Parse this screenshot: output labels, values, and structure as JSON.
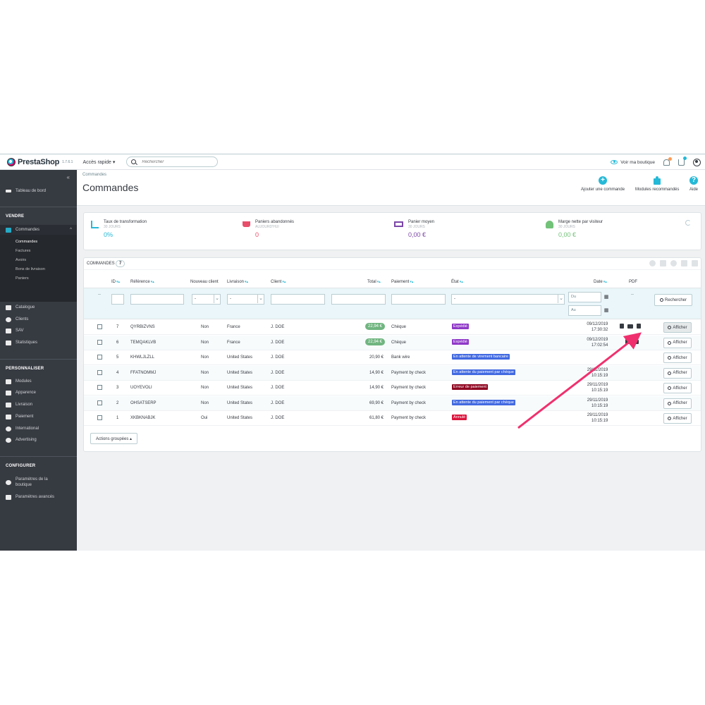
{
  "header": {
    "logo": "PrestaShop",
    "version": "1.7.6.1",
    "quick_access": "Accès rapide ▾",
    "search_placeholder": "Rechercher",
    "view_shop": "Voir ma boutique",
    "colors": {
      "accent": "#25b9d7",
      "brand_pink": "#df0067",
      "notif": "#ff9a52"
    }
  },
  "sidebar": {
    "collapse": "«",
    "dashboard": "Tableau de bord",
    "sections": {
      "sell": "VENDRE",
      "customize": "PERSONNALISER",
      "configure": "CONFIGURER"
    },
    "orders": "Commandes",
    "orders_sub": [
      "Commandes",
      "Factures",
      "Avoirs",
      "Bons de livraison",
      "Paniers"
    ],
    "sell_items": [
      "Catalogue",
      "Clients",
      "SAV",
      "Statistiques"
    ],
    "customize_items": [
      "Modules",
      "Apparence",
      "Livraison",
      "Paiement",
      "International",
      "Advertising"
    ],
    "configure_items": [
      "Paramètres de la boutique",
      "Paramètres avancés"
    ]
  },
  "page": {
    "breadcrumb": "Commandes",
    "title": "Commandes",
    "toolbar": {
      "add_order": "Ajouter une commande",
      "recommended_modules": "Modules recommandés",
      "help": "Aide"
    }
  },
  "kpis": [
    {
      "label": "Taux de transformation",
      "sub": "30 jours",
      "value": "0%",
      "color": "#25b9d7",
      "icon": "sort-chart-icon"
    },
    {
      "label": "Paniers abandonnés",
      "sub": "Aujourd'hui",
      "value": "0",
      "color": "#e84e6a",
      "icon": "cart-icon"
    },
    {
      "label": "Panier moyen",
      "sub": "30 jours",
      "value": "0,00 €",
      "color": "#7c47a8",
      "icon": "money-icon"
    },
    {
      "label": "Marge nette par visiteur",
      "sub": "30 jours",
      "value": "0,00 €",
      "color": "#72c279",
      "icon": "user-icon"
    }
  ],
  "orders": {
    "panel_title": "COMMANDES",
    "count": "7",
    "columns": {
      "id": "ID",
      "reference": "Référence",
      "new_client": "Nouveau client",
      "delivery": "Livraison",
      "client": "Client",
      "total": "Total",
      "payment": "Paiement",
      "state": "État",
      "date": "Date",
      "pdf": "PDF"
    },
    "filters": {
      "dash": "--",
      "select_default": "-",
      "date_from": "Du",
      "date_to": "Au",
      "search_button": "Rechercher"
    },
    "view_label": "Afficher",
    "bulk_actions": "Actions groupées ▴",
    "rows": [
      {
        "id": "7",
        "ref": "QYRBIZVNS",
        "new": "Non",
        "country": "France",
        "client": "J. DOE",
        "total": "22,94 €",
        "total_badge": true,
        "payment": "Chèque",
        "state": "Expédié",
        "state_color": "#8f38c8",
        "date": "09/12/2019",
        "time": "17:30:32",
        "pdf": 3
      },
      {
        "id": "6",
        "ref": "TEMQAKLVB",
        "new": "Non",
        "country": "France",
        "client": "J. DOE",
        "total": "22,94 €",
        "total_badge": true,
        "payment": "Chèque",
        "state": "Expédié",
        "state_color": "#8f38c8",
        "date": "09/12/2019",
        "time": "17:02:54",
        "pdf": 2
      },
      {
        "id": "5",
        "ref": "KHWLJLZLL",
        "new": "Non",
        "country": "United States",
        "client": "J. DOE",
        "total": "20,90 €",
        "total_badge": false,
        "payment": "Bank wire",
        "state": "En attente de virement bancaire",
        "state_color": "#4169e1",
        "date": "",
        "time": "",
        "pdf": 0
      },
      {
        "id": "4",
        "ref": "FFATNOMMJ",
        "new": "Non",
        "country": "United States",
        "client": "J. DOE",
        "total": "14,90 €",
        "total_badge": false,
        "payment": "Payment by check",
        "state": "En attente du paiement par chèque",
        "state_color": "#4169e1",
        "date": "29/11/2019",
        "time": "10:15:19",
        "pdf": 0
      },
      {
        "id": "3",
        "ref": "UOYEVOLI",
        "new": "Non",
        "country": "United States",
        "client": "J. DOE",
        "total": "14,90 €",
        "total_badge": false,
        "payment": "Payment by check",
        "state": "Erreur de paiement",
        "state_color": "#8f0621",
        "date": "29/11/2019",
        "time": "10:15:19",
        "pdf": 0
      },
      {
        "id": "2",
        "ref": "OHSATSERP",
        "new": "Non",
        "country": "United States",
        "client": "J. DOE",
        "total": "69,90 €",
        "total_badge": false,
        "payment": "Payment by check",
        "state": "En attente du paiement par chèque",
        "state_color": "#4169e1",
        "date": "29/11/2019",
        "time": "10:15:19",
        "pdf": 0
      },
      {
        "id": "1",
        "ref": "XKBKNABJK",
        "new": "Oui",
        "country": "United States",
        "client": "J. DOE",
        "total": "61,80 €",
        "total_badge": false,
        "payment": "Payment by check",
        "state": "Annulé",
        "state_color": "#dc143c",
        "date": "29/11/2019",
        "time": "10:15:19",
        "pdf": 0
      }
    ]
  },
  "annotation": {
    "arrow_color": "#f0306e"
  }
}
